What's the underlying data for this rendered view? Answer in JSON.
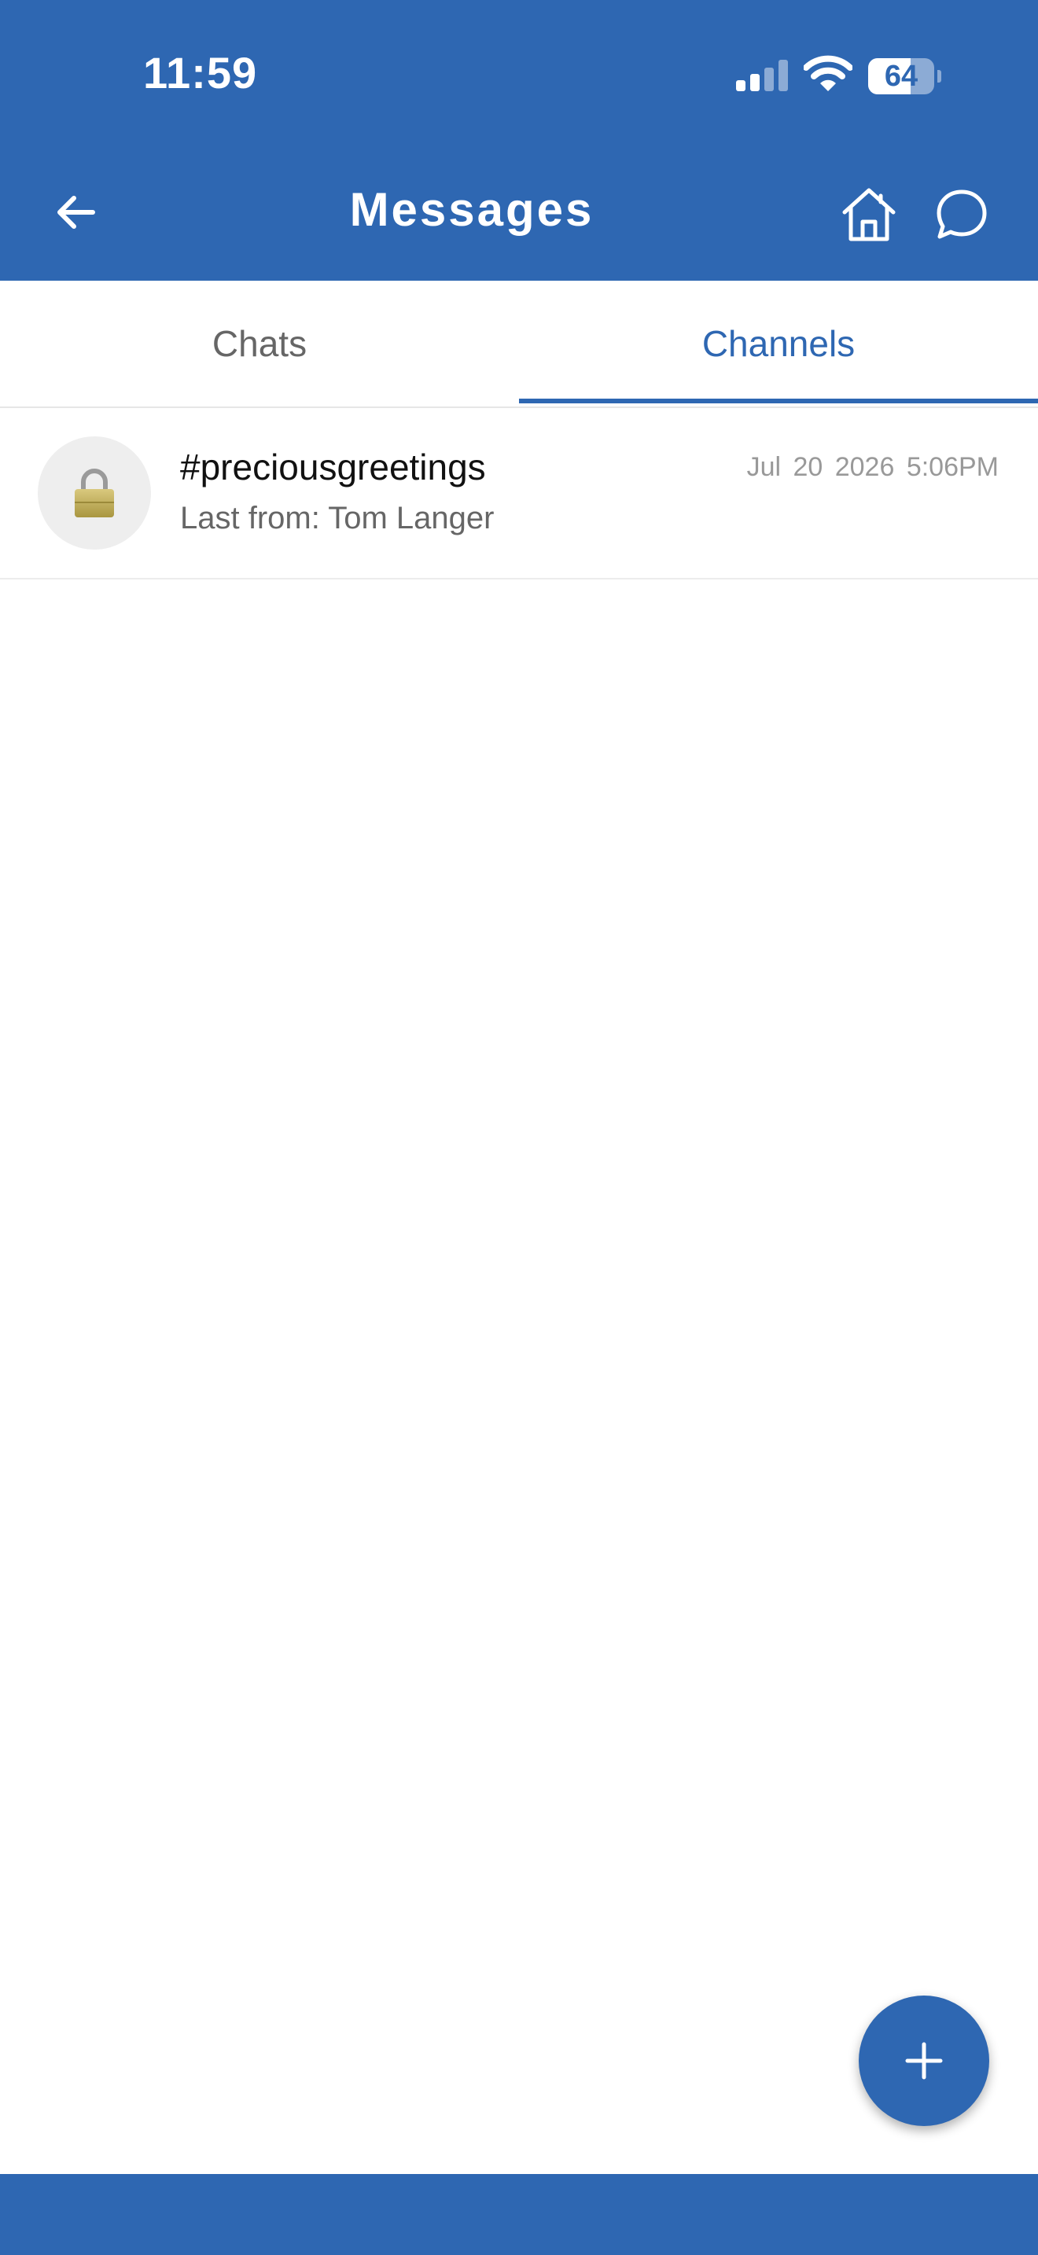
{
  "status_bar": {
    "time": "11:59",
    "battery_level": 64,
    "battery_text": "64"
  },
  "header": {
    "title": "Messages",
    "back_icon": "arrow-left-icon",
    "home_icon": "home-icon",
    "chat_icon": "chat-bubble-icon"
  },
  "tabs": [
    {
      "label": "Chats",
      "active": false
    },
    {
      "label": "Channels",
      "active": true
    }
  ],
  "channels": [
    {
      "name": "#preciousgreetings",
      "subtitle": "Last from: Tom Langer",
      "date": "Jul 20 2026",
      "time": "5:06PM",
      "date_time": "Jul 20 2026  5:06PM",
      "avatar_icon": "lock-icon"
    }
  ],
  "fab": {
    "icon": "plus-icon"
  },
  "colors": {
    "primary": "#2E67B2",
    "background": "#FFFFFF",
    "text_primary": "#111111",
    "text_secondary": "#666666",
    "text_muted": "#999999"
  }
}
